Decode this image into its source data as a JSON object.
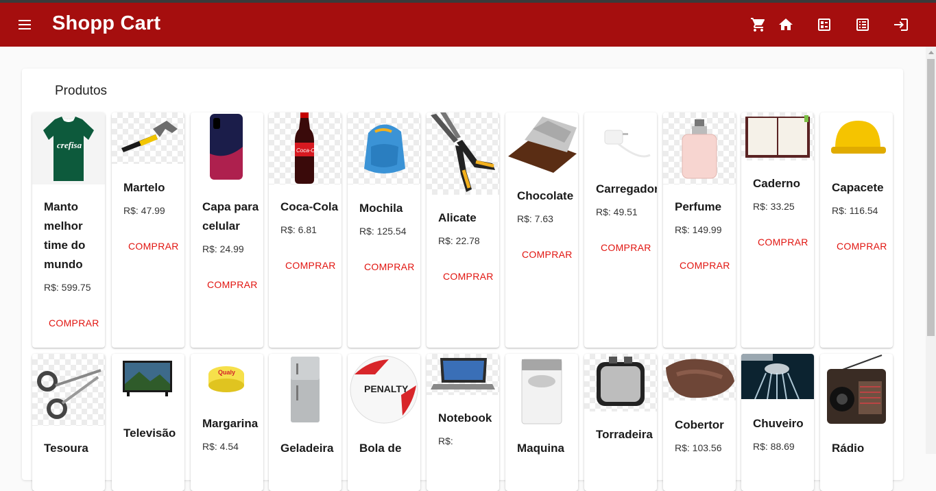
{
  "app": {
    "title": "Shopp Cart"
  },
  "toolbar": {
    "icons": [
      "menu-icon",
      "cart-icon",
      "home-icon",
      "dashboard-icon",
      "list-icon",
      "login-icon"
    ]
  },
  "section": {
    "title": "Produtos"
  },
  "buy_label": "COMPRAR",
  "colors": {
    "toolbar": "#a50e0e",
    "buy": "#e1140f",
    "background": "#fafafa"
  },
  "products_row1": [
    {
      "name": "Manto melhor time do mundo",
      "price": "R$: 599.75",
      "image": "green-jersey"
    },
    {
      "name": "Martelo",
      "price": "R$: 47.99",
      "image": "hammer"
    },
    {
      "name": "Capa para celular",
      "price": "R$: 24.99",
      "image": "phone-case"
    },
    {
      "name": "Coca-Cola",
      "price": "R$: 6.81",
      "image": "coke-bottle"
    },
    {
      "name": "Mochila",
      "price": "R$: 125.54",
      "image": "backpack"
    },
    {
      "name": "Alicate",
      "price": "R$: 22.78",
      "image": "pliers"
    },
    {
      "name": "Chocolate",
      "price": "R$: 7.63",
      "image": "chocolate-bar"
    },
    {
      "name": "Carregador",
      "price": "R$: 49.51",
      "image": "charger"
    },
    {
      "name": "Perfume",
      "price": "R$: 149.99",
      "image": "perfume-bottle"
    },
    {
      "name": "Caderno",
      "price": "R$: 33.25",
      "image": "notebook-paper"
    },
    {
      "name": "Capacete",
      "price": "R$: 116.54",
      "image": "hard-hat"
    }
  ],
  "products_row2": [
    {
      "name": "Tesoura",
      "price": "",
      "image": "scissors"
    },
    {
      "name": "Televisão",
      "price": "",
      "image": "television"
    },
    {
      "name": "Margarina",
      "price": "R$: 4.54",
      "image": "margarine"
    },
    {
      "name": "Geladeira",
      "price": "",
      "image": "fridge"
    },
    {
      "name": "Bola de",
      "price": "",
      "image": "soccer-ball"
    },
    {
      "name": "Notebook",
      "price": "R$:",
      "image": "laptop"
    },
    {
      "name": "Maquina",
      "price": "",
      "image": "washing-machine"
    },
    {
      "name": "Torradeira",
      "price": "",
      "image": "toaster"
    },
    {
      "name": "Cobertor",
      "price": "R$: 103.56",
      "image": "blanket"
    },
    {
      "name": "Chuveiro",
      "price": "R$: 88.69",
      "image": "shower-head"
    },
    {
      "name": "Rádio",
      "price": "",
      "image": "radio"
    }
  ]
}
